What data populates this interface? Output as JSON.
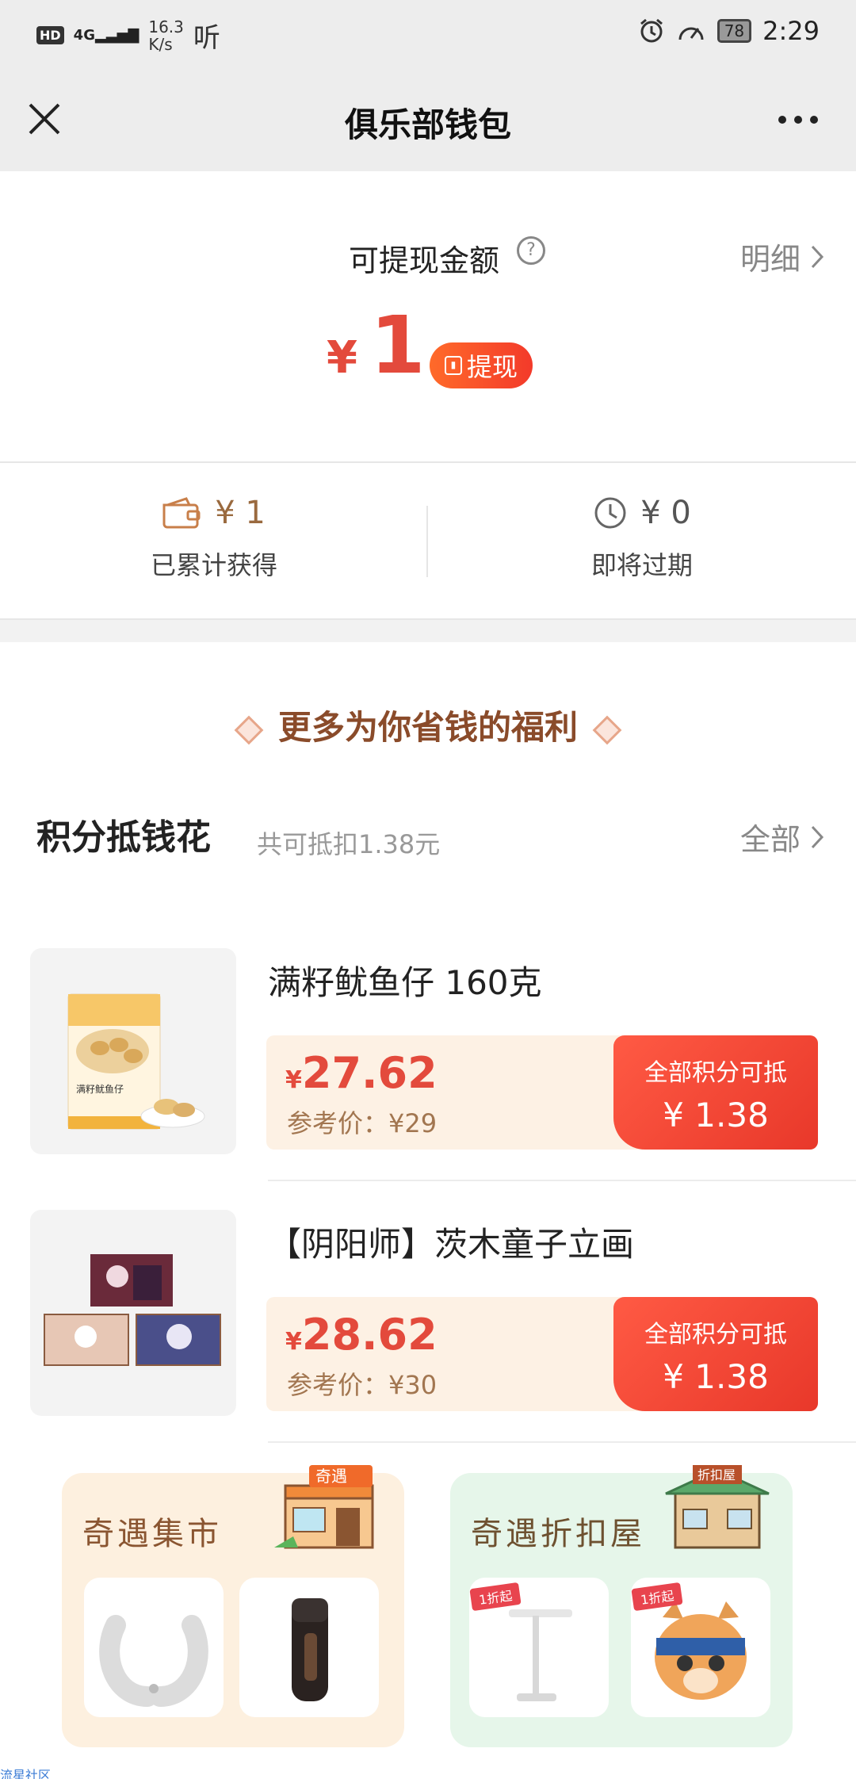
{
  "status_bar": {
    "hd": "HD",
    "network": "4G",
    "speed_value": "16.3",
    "speed_unit": "K/s",
    "app_glyph": "听",
    "battery": "78",
    "time": "2:29"
  },
  "nav": {
    "title": "俱乐部钱包"
  },
  "balance": {
    "label": "可提现金额",
    "help": "?",
    "detail_link": "明细",
    "currency": "¥",
    "amount": "1",
    "withdraw_label": "提现"
  },
  "stats": {
    "earned_value": "¥ 1",
    "earned_label": "已累计获得",
    "expiring_value": "¥ 0",
    "expiring_label": "即将过期"
  },
  "benefits": {
    "title": "更多为你省钱的福利"
  },
  "points": {
    "title": "积分抵钱花",
    "subtitle": "共可抵扣1.38元",
    "all_link": "全部",
    "products": [
      {
        "name": "满籽鱿鱼仔 160克",
        "currency": "¥",
        "price": "27.62",
        "ref_price": "参考价：¥29",
        "deduct_label": "全部积分可抵",
        "deduct_value": "¥ 1.38",
        "package_text": "满籽鱿鱼仔"
      },
      {
        "name": "【阴阳师】茨木童子立画",
        "currency": "¥",
        "price": "28.62",
        "ref_price": "参考价：¥30",
        "deduct_label": "全部积分可抵",
        "deduct_value": "¥ 1.38"
      }
    ]
  },
  "cards": {
    "market_title": "奇遇集市",
    "market_sign": "奇遇",
    "discount_title": "奇遇折扣屋",
    "discount_sign": "折扣屋",
    "discount_badge": "1折起"
  },
  "footer": {
    "text": "流星社区"
  },
  "colors": {
    "accent_red": "#e34a3c",
    "brown": "#9a6a3f",
    "price_bg": "#fdf1e4"
  }
}
